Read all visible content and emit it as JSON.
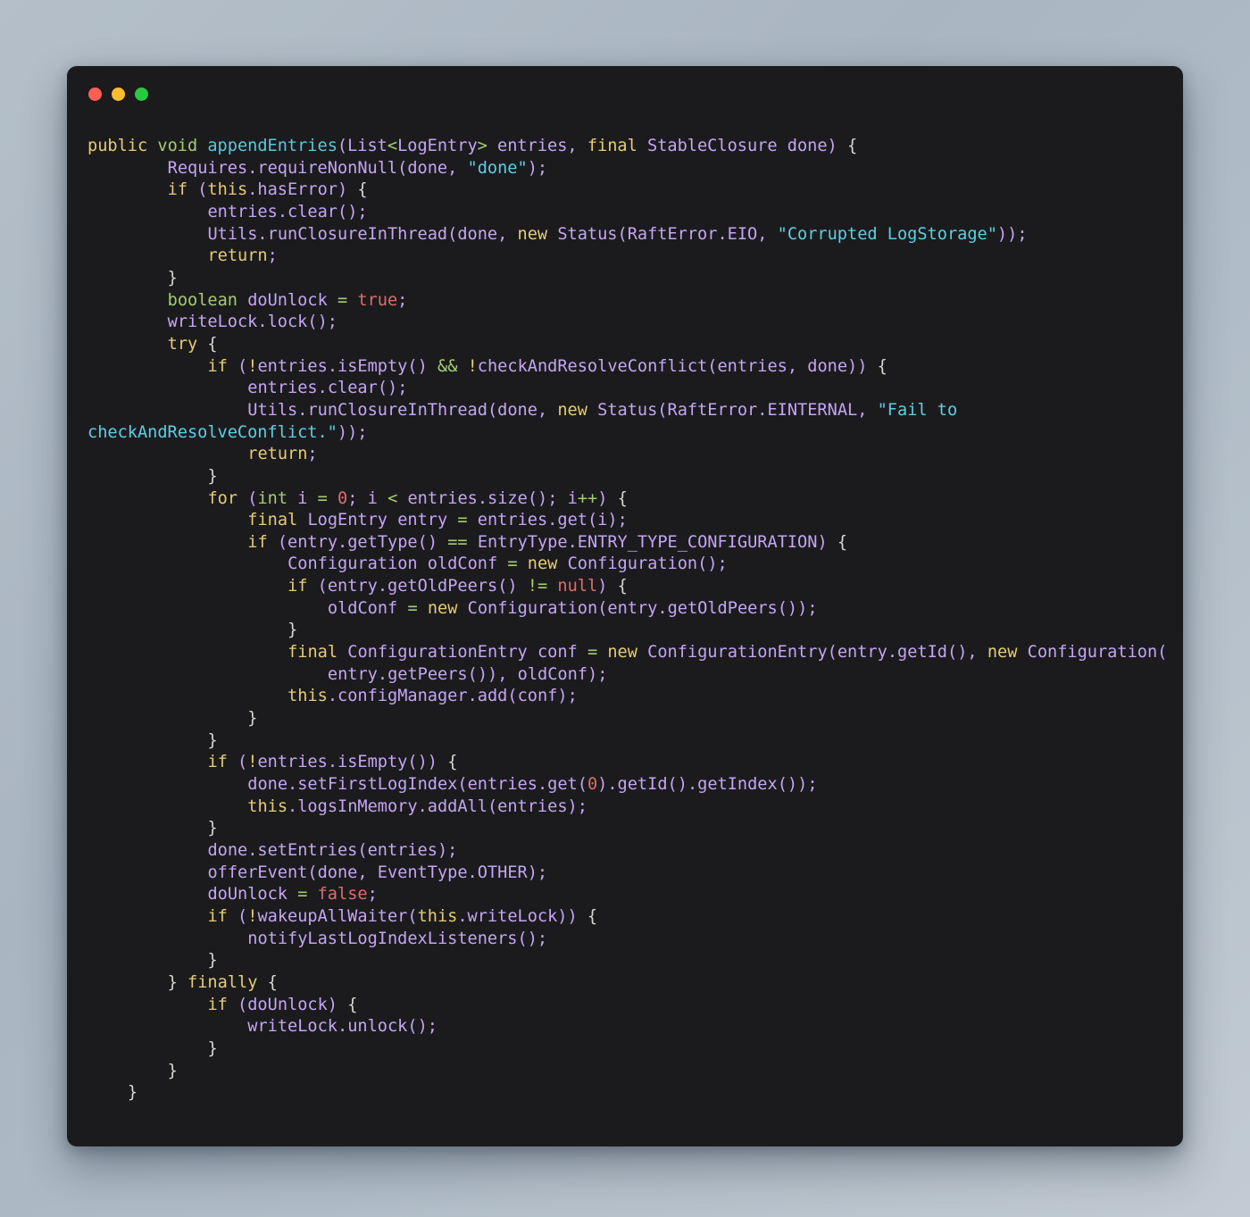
{
  "window": {
    "name": "code-snippet-window",
    "background_color": "#1b1b1d",
    "page_background": "#aebac6",
    "traffic_lights": [
      {
        "name": "close-button-dot",
        "label": "close",
        "color": "#ff5f56"
      },
      {
        "name": "minimize-button-dot",
        "label": "minimize",
        "color": "#ffbd2e"
      },
      {
        "name": "maximize-button-dot",
        "label": "maximize",
        "color": "#27c93f"
      }
    ]
  },
  "theme": {
    "keyword": "#e6cc73",
    "primitive_type": "#a6cc70",
    "function_name": "#5bc8e0",
    "identifier": "#c5a5f5",
    "string": "#5ccfe6",
    "number_literal": "#e06c6c",
    "operator": "#a6cc70",
    "default_text": "#cbccc6"
  },
  "code": {
    "language": "java",
    "method_name": "appendEntries",
    "full_text": "public void appendEntries(List<LogEntry> entries, final StableClosure done) {\n        Requires.requireNonNull(done, \"done\");\n        if (this.hasError) {\n            entries.clear();\n            Utils.runClosureInThread(done, new Status(RaftError.EIO, \"Corrupted LogStorage\"));\n            return;\n        }\n        boolean doUnlock = true;\n        writeLock.lock();\n        try {\n            if (!entries.isEmpty() && !checkAndResolveConflict(entries, done)) {\n                entries.clear();\n                Utils.runClosureInThread(done, new Status(RaftError.EINTERNAL, \"Fail to checkAndResolveConflict.\"));\n                return;\n            }\n            for (int i = 0; i < entries.size(); i++) {\n                final LogEntry entry = entries.get(i);\n                if (entry.getType() == EntryType.ENTRY_TYPE_CONFIGURATION) {\n                    Configuration oldConf = new Configuration();\n                    if (entry.getOldPeers() != null) {\n                        oldConf = new Configuration(entry.getOldPeers());\n                    }\n                    final ConfigurationEntry conf = new ConfigurationEntry(entry.getId(), new Configuration(\n                        entry.getPeers()), oldConf);\n                    this.configManager.add(conf);\n                }\n            }\n            if (!entries.isEmpty()) {\n                done.setFirstLogIndex(entries.get(0).getId().getIndex());\n                this.logsInMemory.addAll(entries);\n            }\n            done.setEntries(entries);\n            offerEvent(done, EventType.OTHER);\n            doUnlock = false;\n            if (!wakeupAllWaiter(this.writeLock)) {\n                notifyLastLogIndexListeners();\n            }\n        } finally {\n            if (doUnlock) {\n                writeLock.unlock();\n            }\n        }\n    }",
    "lines": [
      "public void appendEntries(List<LogEntry> entries, final StableClosure done) {",
      "        Requires.requireNonNull(done, \"done\");",
      "        if (this.hasError) {",
      "            entries.clear();",
      "            Utils.runClosureInThread(done, new Status(RaftError.EIO, \"Corrupted LogStorage\"));",
      "            return;",
      "        }",
      "        boolean doUnlock = true;",
      "        writeLock.lock();",
      "        try {",
      "            if (!entries.isEmpty() && !checkAndResolveConflict(entries, done)) {",
      "                entries.clear();",
      "                Utils.runClosureInThread(done, new Status(RaftError.EINTERNAL, \"Fail to checkAndResolveConflict.\"));",
      "                return;",
      "            }",
      "            for (int i = 0; i < entries.size(); i++) {",
      "                final LogEntry entry = entries.get(i);",
      "                if (entry.getType() == EntryType.ENTRY_TYPE_CONFIGURATION) {",
      "                    Configuration oldConf = new Configuration();",
      "                    if (entry.getOldPeers() != null) {",
      "                        oldConf = new Configuration(entry.getOldPeers());",
      "                    }",
      "                    final ConfigurationEntry conf = new ConfigurationEntry(entry.getId(), new Configuration(",
      "                        entry.getPeers()), oldConf);",
      "                    this.configManager.add(conf);",
      "                }",
      "            }",
      "            if (!entries.isEmpty()) {",
      "                done.setFirstLogIndex(entries.get(0).getId().getIndex());",
      "                this.logsInMemory.addAll(entries);",
      "            }",
      "            done.setEntries(entries);",
      "            offerEvent(done, EventType.OTHER);",
      "            doUnlock = false;",
      "            if (!wakeupAllWaiter(this.writeLock)) {",
      "                notifyLastLogIndexListeners();",
      "            }",
      "        } finally {",
      "            if (doUnlock) {",
      "                writeLock.unlock();",
      "            }",
      "        }",
      "    }"
    ]
  }
}
